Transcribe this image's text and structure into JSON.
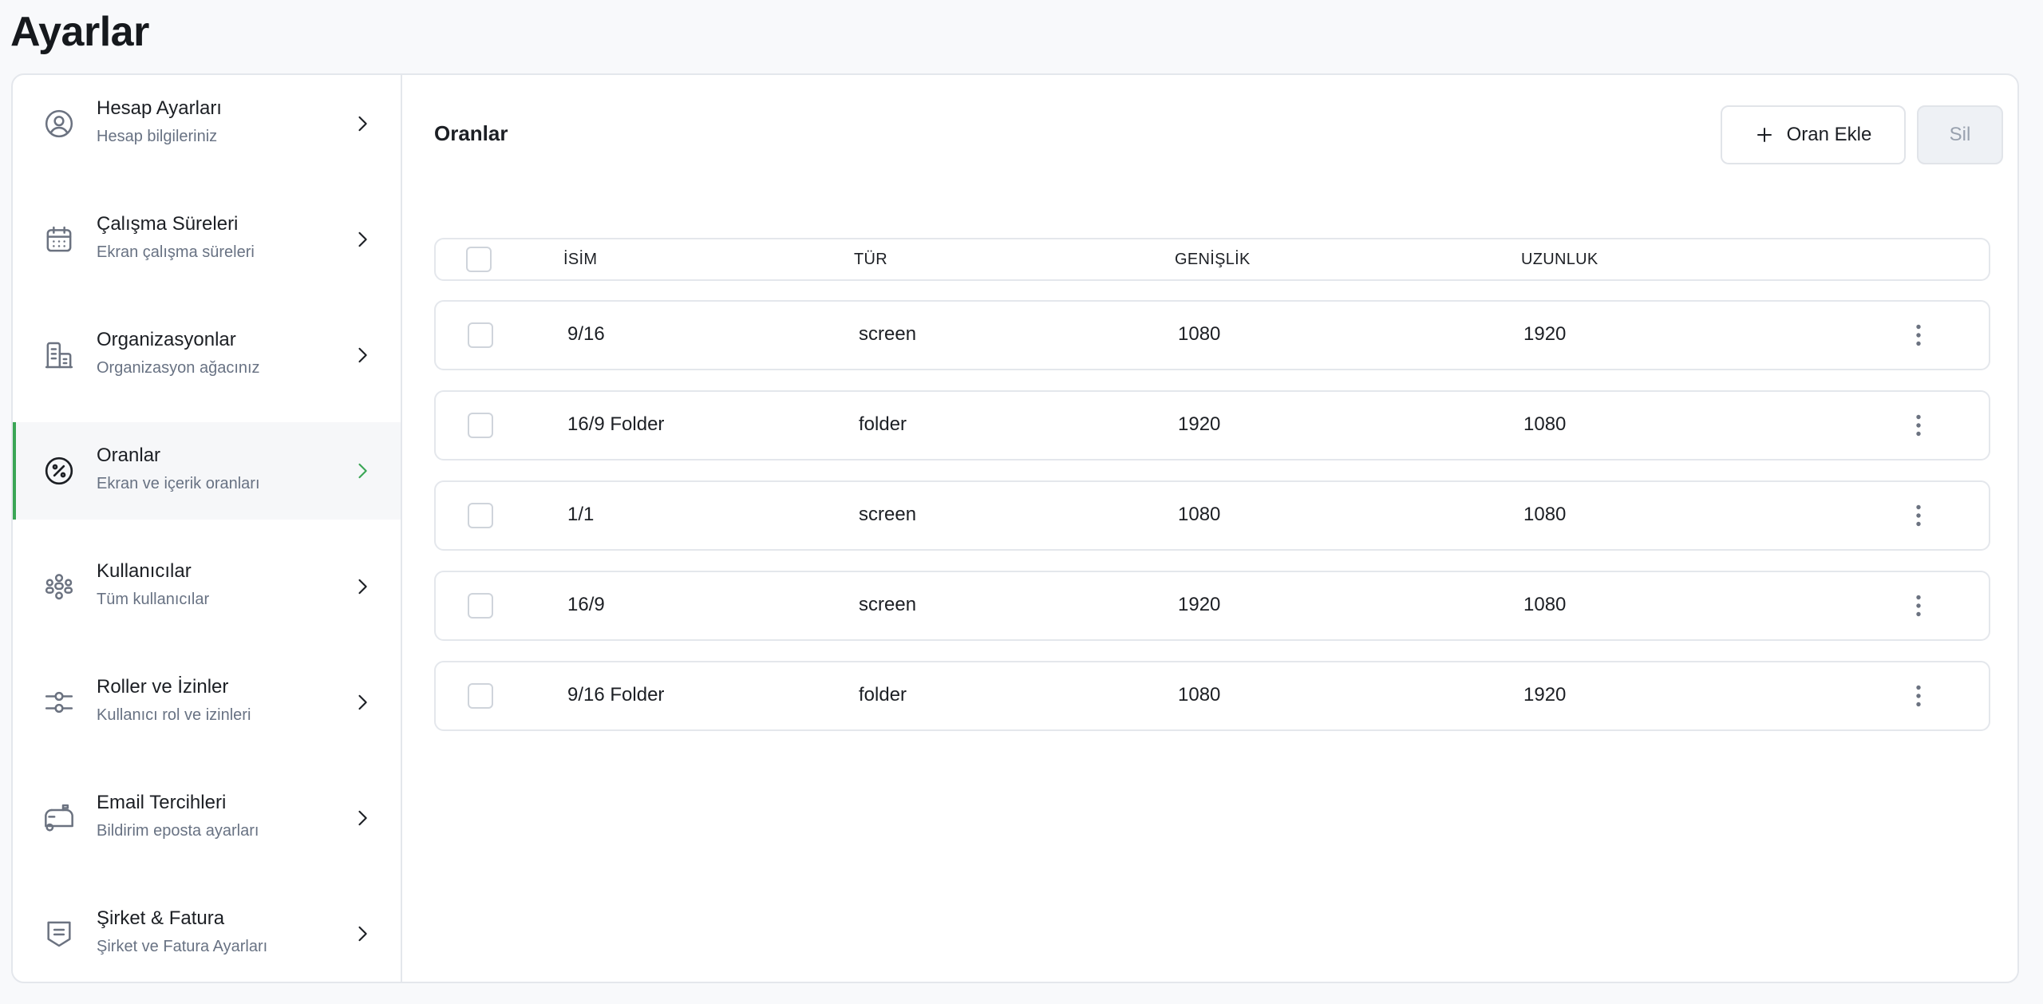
{
  "page": {
    "title": "Ayarlar"
  },
  "sidebar": {
    "items": [
      {
        "label": "Hesap Ayarları",
        "sub": "Hesap bilgileriniz",
        "icon": "user-circle-icon"
      },
      {
        "label": "Çalışma Süreleri",
        "sub": "Ekran çalışma süreleri",
        "icon": "calendar-icon"
      },
      {
        "label": "Organizasyonlar",
        "sub": "Organizasyon ağacınız",
        "icon": "buildings-icon"
      },
      {
        "label": "Oranlar",
        "sub": "Ekran ve içerik oranları",
        "icon": "percent-icon",
        "active": true
      },
      {
        "label": "Kullanıcılar",
        "sub": "Tüm kullanıcılar",
        "icon": "users-icon"
      },
      {
        "label": "Roller ve İzinler",
        "sub": "Kullanıcı rol ve izinleri",
        "icon": "sliders-icon"
      },
      {
        "label": "Email Tercihleri",
        "sub": "Bildirim eposta ayarları",
        "icon": "mailbox-icon"
      },
      {
        "label": "Şirket & Fatura",
        "sub": "Şirket ve Fatura Ayarları",
        "icon": "invoice-icon"
      }
    ]
  },
  "main": {
    "title": "Oranlar",
    "add_label": "Oran Ekle",
    "delete_label": "Sil"
  },
  "table": {
    "columns": [
      "İSİM",
      "TÜR",
      "GENİŞLİK",
      "UZUNLUK"
    ],
    "rows": [
      {
        "name": "9/16",
        "type": "screen",
        "width": "1080",
        "height": "1920"
      },
      {
        "name": "16/9 Folder",
        "type": "folder",
        "width": "1920",
        "height": "1080"
      },
      {
        "name": "1/1",
        "type": "screen",
        "width": "1080",
        "height": "1080"
      },
      {
        "name": "16/9",
        "type": "screen",
        "width": "1920",
        "height": "1080"
      },
      {
        "name": "9/16 Folder",
        "type": "folder",
        "width": "1080",
        "height": "1920"
      }
    ]
  },
  "colors": {
    "accent": "#3aa655",
    "border": "#e4e7ec",
    "muted": "#687283"
  }
}
